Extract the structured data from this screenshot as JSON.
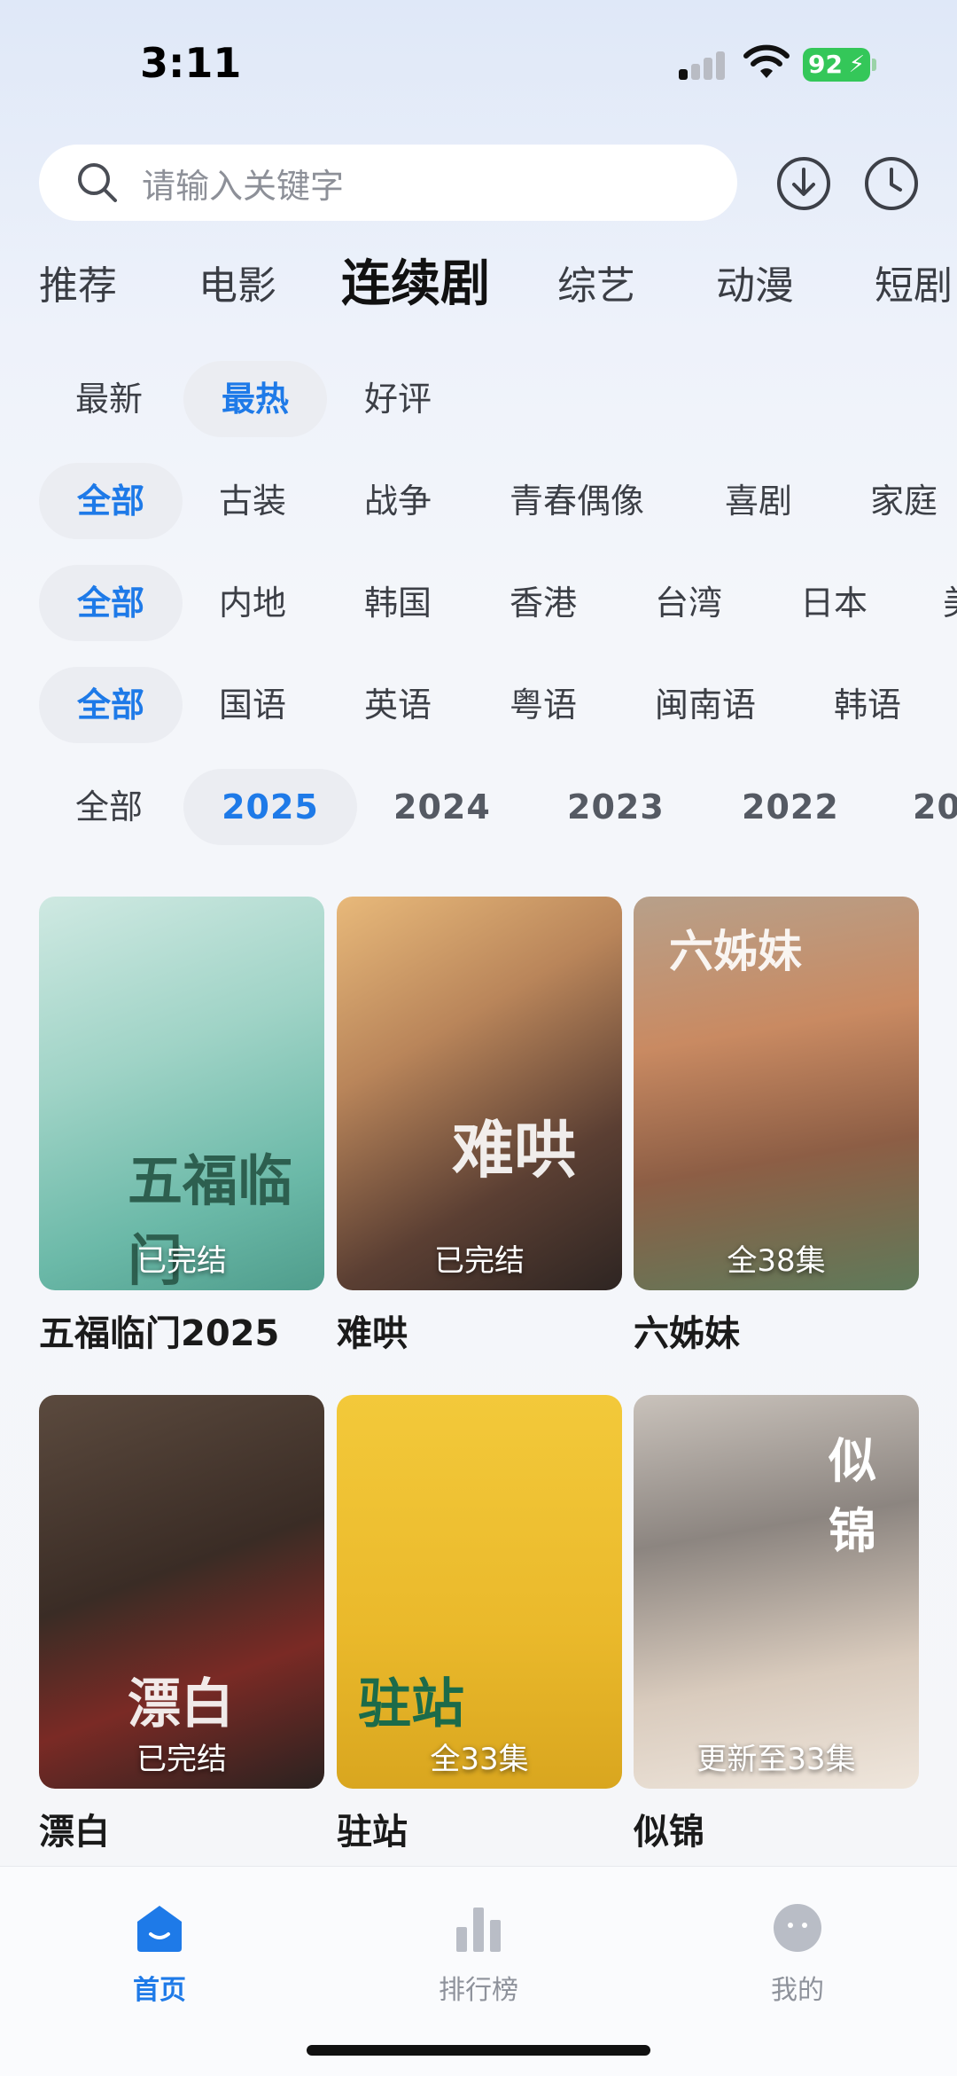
{
  "status_bar": {
    "time": "3:11",
    "battery": "92"
  },
  "search": {
    "placeholder": "请输入关键字"
  },
  "channel_tabs": [
    {
      "label": "推荐",
      "active": false
    },
    {
      "label": "电影",
      "active": false
    },
    {
      "label": "连续剧",
      "active": true
    },
    {
      "label": "综艺",
      "active": false
    },
    {
      "label": "动漫",
      "active": false
    },
    {
      "label": "短剧",
      "active": false
    }
  ],
  "filters": {
    "sort": [
      "最新",
      "最热",
      "好评"
    ],
    "sort_active": "最热",
    "genre": [
      "全部",
      "古装",
      "战争",
      "青春偶像",
      "喜剧",
      "家庭"
    ],
    "region": [
      "全部",
      "内地",
      "韩国",
      "香港",
      "台湾",
      "日本",
      "美"
    ],
    "language": [
      "全部",
      "国语",
      "英语",
      "粤语",
      "闽南语",
      "韩语"
    ],
    "year": [
      "全部",
      "2025",
      "2024",
      "2023",
      "2022",
      "20"
    ],
    "year_active": "2025"
  },
  "shows": [
    {
      "title": "五福临门2025",
      "status": "已完结",
      "poster_text": "五福临门"
    },
    {
      "title": "难哄",
      "status": "已完结",
      "poster_text": "难哄"
    },
    {
      "title": "六姊妹",
      "status": "全38集",
      "poster_text": "六姊妹"
    },
    {
      "title": "漂白",
      "status": "已完结",
      "poster_text": "漂白"
    },
    {
      "title": "驻站",
      "status": "全33集",
      "poster_text": "驻站"
    },
    {
      "title": "似锦",
      "status": "更新至33集",
      "poster_text": "似锦"
    }
  ],
  "nav": [
    {
      "label": "首页",
      "icon": "home-icon",
      "active": true
    },
    {
      "label": "排行榜",
      "icon": "chart-icon",
      "active": false
    },
    {
      "label": "我的",
      "icon": "profile-icon",
      "active": false
    }
  ],
  "colors": {
    "accent": "#1e7ae8",
    "battery": "#34c759"
  }
}
